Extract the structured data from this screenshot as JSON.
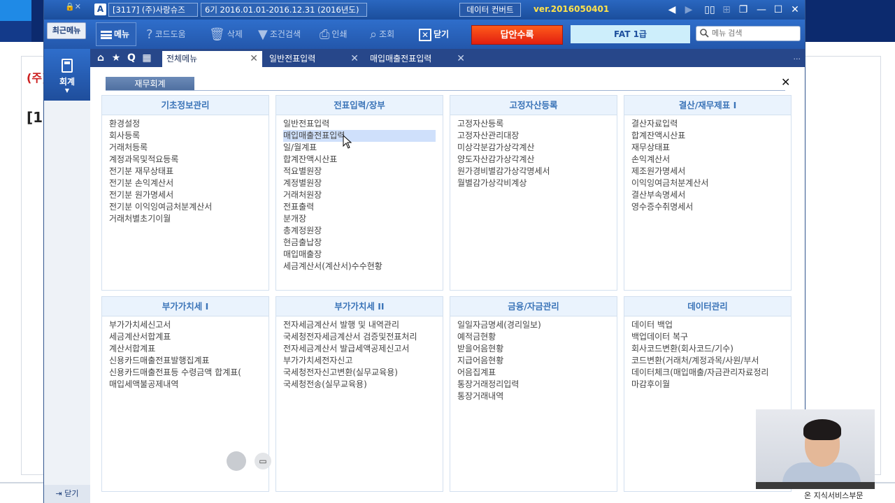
{
  "desktop": {
    "fragment1": "(주)",
    "fragment2": "[1"
  },
  "window": {
    "company": "[3117] (주)사랑슈즈",
    "period": "6기 2016.01.01-2016.12.31 (2016년도)",
    "convert_label": "데이터 컨버트",
    "version": "ver.2016050401"
  },
  "toolbar": {
    "recent_menu": "최근메뉴",
    "menu": "메뉴",
    "code_help": "코드도움",
    "delete": "삭제",
    "condition_search": "조건검색",
    "print": "인쇄",
    "inquiry": "조회",
    "close": "닫기",
    "submit_answer": "답안수록",
    "grade": "FAT 1급",
    "search_placeholder": "메뉴 검색"
  },
  "sidebar": {
    "accounting": "회계",
    "close": "닫기"
  },
  "tabs": {
    "all_menu": "전체메뉴",
    "general_voucher": "일반전표입력",
    "purchase_sales_voucher": "매입매출전표입력",
    "more": "..."
  },
  "content": {
    "category": "재무회계",
    "panels": [
      {
        "title": "기초정보관리",
        "items": [
          "환경설정",
          "회사등록",
          "거래처등록",
          "계정과목및적요등록",
          "전기분 재무상태표",
          "전기분 손익계산서",
          "전기분 원가명세서",
          "전기분 이익잉여금처분계산서",
          "거래처별초기이월"
        ]
      },
      {
        "title": "전표입력/장부",
        "items": [
          "일반전표입력",
          "매입매출전표입력",
          "일/월계표",
          "합계잔액시산표",
          "적요별원장",
          "계정별원장",
          "거래처원장",
          "전표출력",
          "분개장",
          "총계정원장",
          "현금출납장",
          "매입매출장",
          "세금계산서(계산서)수수현황"
        ],
        "selected": "매입매출전표입력"
      },
      {
        "title": "고정자산등록",
        "items": [
          "고정자산등록",
          "고정자산관리대장",
          "미상각분감가상각계산",
          "양도자산감가상각계산",
          "원가경비별감가상각명세서",
          "월별감가상각비계상"
        ]
      },
      {
        "title": "결산/재무제표 I",
        "items": [
          "결산자료입력",
          "합계잔액시산표",
          "재무상태표",
          "손익계산서",
          "제조원가명세서",
          "이익잉여금처분계산서",
          "결산부속명세서",
          "영수증수취명세서"
        ]
      },
      {
        "title": "부가가치세 I",
        "items": [
          "부가가치세신고서",
          "세금계산서합계표",
          "계산서합계표",
          "신용카드매출전표발행집계표",
          "신용카드매출전표등 수령금액 합계표(",
          "매입세액불공제내역"
        ]
      },
      {
        "title": "부가가치세 II",
        "items": [
          "전자세금계산서 발행 및 내역관리",
          "국세청전자세금계산서 검증및전표처리",
          "전자세금계산서 발급세액공제신고서",
          "부가가치세전자신고",
          "국세청전자신고변환(실무교육용)",
          "국세청전송(실무교육용)"
        ]
      },
      {
        "title": "금융/자금관리",
        "items": [
          "일일자금명세(경리일보)",
          "예적금현황",
          "받을어음현황",
          "지급어음현황",
          "어음집계표",
          "통장거래정리입력",
          "통장거래내역"
        ]
      },
      {
        "title": "데이터관리",
        "items": [
          "데이터 백업",
          "백업데이터 복구",
          "회사코드변환(회사코드/기수)",
          "코드변환(거래처/계정과목/사원/부서",
          "데이터체크(매입매출/자금관리자료정리",
          "마감후이월"
        ]
      }
    ]
  },
  "webcam": {
    "caption": "온 지식서비스부문"
  },
  "colors": {
    "titlebar": "#1b4e9c",
    "toolbar": "#2f6ecb",
    "tabstrip": "#27478a",
    "submit": "#e11f10",
    "grade_bg": "#cdeefb",
    "version": "#ffe24a",
    "panel_title": "#3b74b8",
    "selection": "#cfe0fb"
  }
}
